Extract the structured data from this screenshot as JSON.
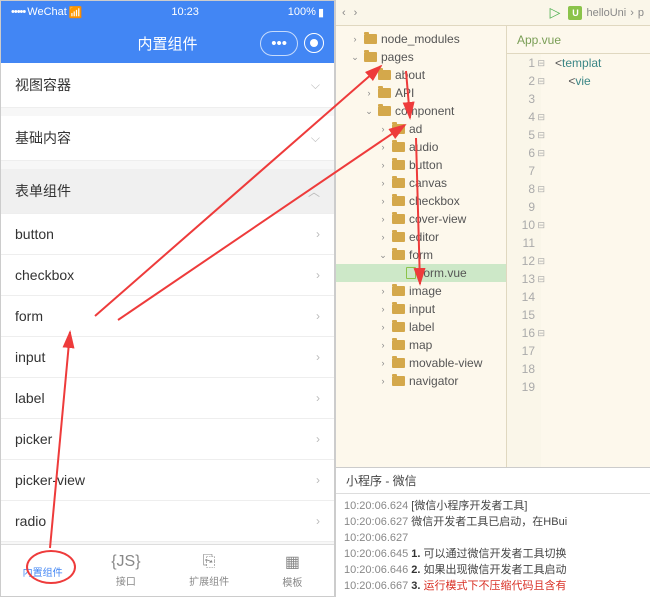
{
  "simulator": {
    "status": {
      "carrier": "WeChat",
      "signal": "•••••",
      "wifi": "⌄",
      "time": "10:23",
      "battery": "100%"
    },
    "nav": {
      "title": "内置组件"
    },
    "sections": [
      {
        "label": "视图容器",
        "expanded": false,
        "chev": "⌵"
      },
      {
        "label": "基础内容",
        "expanded": false,
        "chev": "⌵"
      },
      {
        "label": "表单组件",
        "expanded": true,
        "chev": "︿"
      }
    ],
    "form_items": [
      {
        "label": "button"
      },
      {
        "label": "checkbox"
      },
      {
        "label": "form"
      },
      {
        "label": "input"
      },
      {
        "label": "label"
      },
      {
        "label": "picker"
      },
      {
        "label": "picker-view"
      },
      {
        "label": "radio"
      }
    ],
    "tabs": [
      {
        "icon": "</>",
        "label": "内置组件"
      },
      {
        "icon": "{JS}",
        "label": "接口"
      },
      {
        "icon": "⎘",
        "label": "扩展组件"
      },
      {
        "icon": "▦",
        "label": "模板"
      }
    ]
  },
  "ide": {
    "breadcrumb": {
      "project": "helloUni",
      "path": "p"
    },
    "tree": [
      {
        "indent": 1,
        "exp": "›",
        "type": "folder",
        "label": "node_modules"
      },
      {
        "indent": 1,
        "exp": "⌄",
        "type": "folder",
        "label": "pages"
      },
      {
        "indent": 2,
        "exp": "›",
        "type": "folder",
        "label": "about"
      },
      {
        "indent": 2,
        "exp": "›",
        "type": "folder",
        "label": "API"
      },
      {
        "indent": 2,
        "exp": "⌄",
        "type": "folder",
        "label": "component"
      },
      {
        "indent": 3,
        "exp": "›",
        "type": "folder",
        "label": "ad"
      },
      {
        "indent": 3,
        "exp": "›",
        "type": "folder",
        "label": "audio"
      },
      {
        "indent": 3,
        "exp": "›",
        "type": "folder",
        "label": "button"
      },
      {
        "indent": 3,
        "exp": "›",
        "type": "folder",
        "label": "canvas"
      },
      {
        "indent": 3,
        "exp": "›",
        "type": "folder",
        "label": "checkbox"
      },
      {
        "indent": 3,
        "exp": "›",
        "type": "folder",
        "label": "cover-view"
      },
      {
        "indent": 3,
        "exp": "›",
        "type": "folder",
        "label": "editor"
      },
      {
        "indent": 3,
        "exp": "⌄",
        "type": "folder",
        "label": "form"
      },
      {
        "indent": 4,
        "exp": "",
        "type": "file",
        "label": "form.vue",
        "selected": true
      },
      {
        "indent": 3,
        "exp": "›",
        "type": "folder",
        "label": "image"
      },
      {
        "indent": 3,
        "exp": "›",
        "type": "folder",
        "label": "input"
      },
      {
        "indent": 3,
        "exp": "›",
        "type": "folder",
        "label": "label"
      },
      {
        "indent": 3,
        "exp": "›",
        "type": "folder",
        "label": "map"
      },
      {
        "indent": 3,
        "exp": "›",
        "type": "folder",
        "label": "movable-view"
      },
      {
        "indent": 3,
        "exp": "›",
        "type": "folder",
        "label": "navigator"
      }
    ],
    "editor": {
      "tab": "App.vue",
      "lines": [
        {
          "n": 1,
          "fold": "⊟",
          "html": "<span class='tag-angle'>&lt;</span><span class='tag-name'>templat</span>"
        },
        {
          "n": 2,
          "fold": "⊟",
          "html": "    <span class='tag-angle'>&lt;</span><span class='tag-name'>vie</span>"
        },
        {
          "n": 3,
          "fold": "",
          "html": ""
        },
        {
          "n": 4,
          "fold": "⊟",
          "html": ""
        },
        {
          "n": 5,
          "fold": "⊟",
          "html": ""
        },
        {
          "n": 6,
          "fold": "⊟",
          "html": ""
        },
        {
          "n": 7,
          "fold": "",
          "html": ""
        },
        {
          "n": 8,
          "fold": "⊟",
          "html": ""
        },
        {
          "n": 9,
          "fold": "",
          "html": ""
        },
        {
          "n": 10,
          "fold": "⊟",
          "html": ""
        },
        {
          "n": 11,
          "fold": "",
          "html": ""
        },
        {
          "n": 12,
          "fold": "⊟",
          "html": ""
        },
        {
          "n": 13,
          "fold": "⊟",
          "html": ""
        },
        {
          "n": 14,
          "fold": "",
          "html": ""
        },
        {
          "n": 15,
          "fold": "",
          "html": ""
        },
        {
          "n": 16,
          "fold": "⊟",
          "html": ""
        },
        {
          "n": 17,
          "fold": "",
          "html": ""
        },
        {
          "n": 18,
          "fold": "",
          "html": ""
        },
        {
          "n": 19,
          "fold": "",
          "html": ""
        }
      ]
    },
    "console": {
      "tab": "小程序 - 微信",
      "lines": [
        {
          "ts": "10:20:06.624",
          "text": "[微信小程序开发者工具]"
        },
        {
          "ts": "10:20:06.627",
          "text": "微信开发者工具已启动，在HBui"
        },
        {
          "ts": "10:20:06.627",
          "text": ""
        },
        {
          "ts": "10:20:06.645",
          "num": "1.",
          "text": "可以通过微信开发者工具切换"
        },
        {
          "ts": "10:20:06.646",
          "num": "2.",
          "text": "如果出现微信开发者工具启动"
        },
        {
          "ts": "10:20:06.667",
          "num": "3.",
          "warn": "运行模式下不压缩代码且含有"
        }
      ]
    }
  }
}
